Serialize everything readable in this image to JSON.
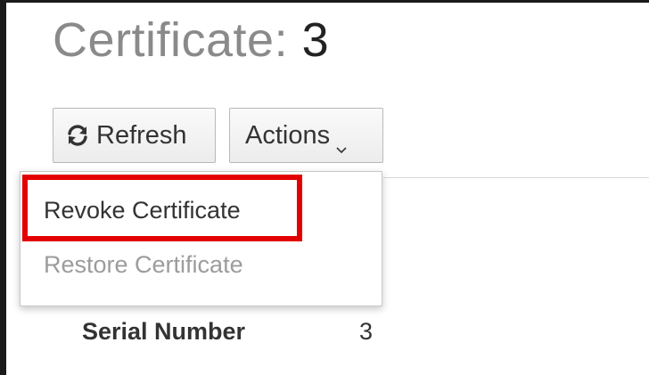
{
  "page": {
    "title_prefix": "Certificate:",
    "title_number": "3"
  },
  "toolbar": {
    "refresh_label": "Refresh",
    "refresh_icon": "refresh-icon",
    "actions_label": "Actions",
    "actions_icon": "chevron-down-icon"
  },
  "actions_menu": {
    "items": [
      {
        "label": "Revoke Certificate",
        "enabled": true,
        "highlighted": true
      },
      {
        "label": "Restore Certificate",
        "enabled": false,
        "highlighted": false
      }
    ]
  },
  "details": {
    "serial_number_label": "Serial Number",
    "serial_number_value": "3"
  },
  "colors": {
    "highlight_border": "#e20000",
    "disabled_text": "#9c9c9c",
    "title_text": "#8a8a8a"
  }
}
